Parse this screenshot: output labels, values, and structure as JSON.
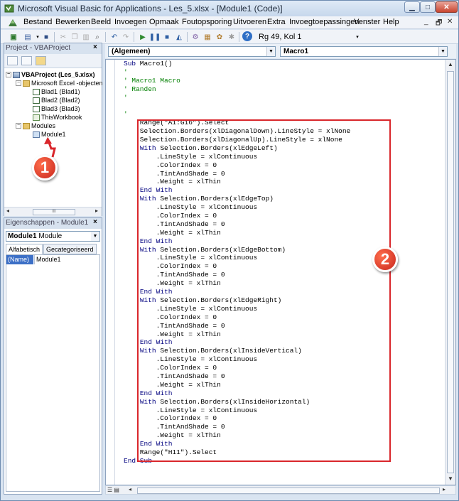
{
  "window": {
    "title": "Microsoft Visual Basic for Applications - Les_5.xlsx - [Module1 (Code)]"
  },
  "menu": [
    "Bestand",
    "Bewerken",
    "Beeld",
    "Invoegen",
    "Opmaak",
    "Foutopsporing",
    "Uitvoeren",
    "Extra",
    "Invoegtoepassingen",
    "Venster",
    "Help"
  ],
  "toolbar": {
    "cursor_position": "Rg 49, Kol 1"
  },
  "project_panel": {
    "title": "Project - VBAProject",
    "tree": {
      "project": "VBAProject (Les_5.xlsx)",
      "excel_objects_folder": "Microsoft Excel -objecten",
      "sheets": [
        "Blad1 (Blad1)",
        "Blad2 (Blad2)",
        "Blad3 (Blad3)"
      ],
      "workbook": "ThisWorkbook",
      "modules_folder": "Modules",
      "module": "Module1"
    }
  },
  "properties_panel": {
    "title": "Eigenschappen - Module1",
    "selected_object": "Module1",
    "selected_type": "Module",
    "tabs": [
      "Alfabetisch",
      "Gecategoriseerd"
    ],
    "row": {
      "key": "(Name)",
      "value": "Module1"
    }
  },
  "code_window": {
    "object_combo": "(Algemeen)",
    "procedure_combo": "Macro1",
    "lines": [
      "Sub Macro1()",
      "'",
      "' Macro1 Macro",
      "' Randen",
      "'",
      "",
      "'",
      "    Range(\"A1:G16\").Select",
      "    Selection.Borders(xlDiagonalDown).LineStyle = xlNone",
      "    Selection.Borders(xlDiagonalUp).LineStyle = xlNone",
      "    With Selection.Borders(xlEdgeLeft)",
      "        .LineStyle = xlContinuous",
      "        .ColorIndex = 0",
      "        .TintAndShade = 0",
      "        .Weight = xlThin",
      "    End With",
      "    With Selection.Borders(xlEdgeTop)",
      "        .LineStyle = xlContinuous",
      "        .ColorIndex = 0",
      "        .TintAndShade = 0",
      "        .Weight = xlThin",
      "    End With",
      "    With Selection.Borders(xlEdgeBottom)",
      "        .LineStyle = xlContinuous",
      "        .ColorIndex = 0",
      "        .TintAndShade = 0",
      "        .Weight = xlThin",
      "    End With",
      "    With Selection.Borders(xlEdgeRight)",
      "        .LineStyle = xlContinuous",
      "        .ColorIndex = 0",
      "        .TintAndShade = 0",
      "        .Weight = xlThin",
      "    End With",
      "    With Selection.Borders(xlInsideVertical)",
      "        .LineStyle = xlContinuous",
      "        .ColorIndex = 0",
      "        .TintAndShade = 0",
      "        .Weight = xlThin",
      "    End With",
      "    With Selection.Borders(xlInsideHorizontal)",
      "        .LineStyle = xlContinuous",
      "        .ColorIndex = 0",
      "        .TintAndShade = 0",
      "        .Weight = xlThin",
      "    End With",
      "    Range(\"H11\").Select",
      "End Sub",
      ""
    ]
  },
  "callouts": [
    "1",
    "2"
  ],
  "colors": {
    "keyword": "#00007f",
    "comment": "#007f00",
    "highlight": "#d9262b"
  }
}
